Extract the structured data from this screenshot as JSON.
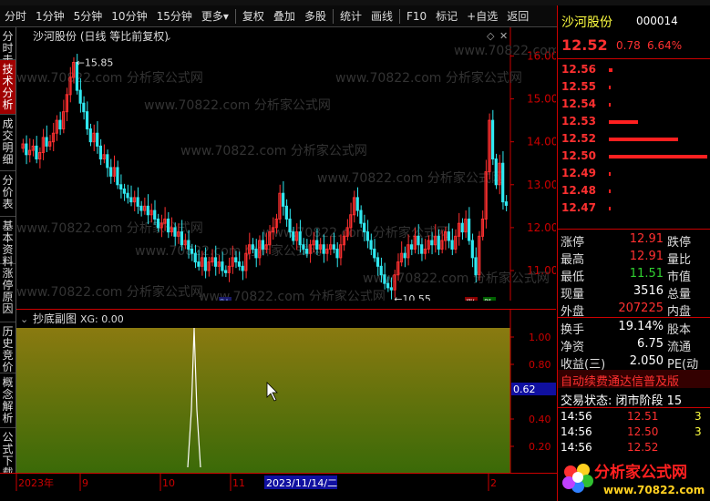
{
  "toolbar": {
    "items": [
      "分时",
      "1分钟",
      "5分钟",
      "10分钟",
      "15分钟",
      "更多",
      "复权",
      "叠加",
      "多股",
      "统计",
      "画线",
      "F10",
      "标记",
      "+自选",
      "返回"
    ],
    "more_arrow": "▾"
  },
  "sidebar": {
    "items": [
      {
        "label": "分时走势",
        "active": false
      },
      {
        "label": "技术分析",
        "active": true
      },
      {
        "label": "成交明细",
        "active": false
      },
      {
        "label": "分价表",
        "active": false
      },
      {
        "label": "基本资料",
        "active": false
      },
      {
        "label": "涨停原因",
        "active": false
      },
      {
        "label": "历史竞价",
        "active": false
      },
      {
        "label": "概念解析",
        "active": false
      },
      {
        "label": "公式下载",
        "active": false
      }
    ]
  },
  "main_chart": {
    "title": "沙河股份 (日线 等比前复权)",
    "high_label": "15.85",
    "low_label": "10.55",
    "cai_marker": "财",
    "limit_up_marker": "涨",
    "limit_down_marker": "跌",
    "y_ticks": [
      "16.00",
      "15.00",
      "14.00",
      "13.00",
      "12.00",
      "11.00"
    ]
  },
  "sub_chart": {
    "title": "抄底副图",
    "indicator": "XG: 0.00",
    "y_ticks": [
      "1.00",
      "0.80",
      "0.62",
      "0.40",
      "0.20"
    ],
    "cursor_value": "0.62"
  },
  "x_axis": {
    "labels": [
      "2023年",
      "9",
      "10",
      "11",
      "2"
    ],
    "cursor_date": "2023/11/14/二"
  },
  "quote": {
    "name": "沙河股份",
    "code": "000014",
    "price": "12.52",
    "change": "0.78",
    "pct": "6.64%",
    "ladder": [
      {
        "price": "12.56",
        "bar": 0.04
      },
      {
        "price": "12.55",
        "bar": 0.02
      },
      {
        "price": "12.54",
        "bar": 0.02
      },
      {
        "price": "12.53",
        "bar": 0.3
      },
      {
        "price": "12.52",
        "bar": 0.7
      },
      {
        "price": "12.50",
        "bar": 1.0
      },
      {
        "price": "12.49",
        "bar": 0.02
      },
      {
        "price": "12.48",
        "bar": 0.02
      },
      {
        "price": "12.47",
        "bar": 0.02
      }
    ],
    "stats": [
      {
        "l1": "涨停",
        "v1": "12.91",
        "c1": "red",
        "l2": "跌停"
      },
      {
        "l1": "最高",
        "v1": "12.91",
        "c1": "red",
        "l2": "量比"
      },
      {
        "l1": "最低",
        "v1": "11.51",
        "c1": "grn",
        "l2": "市值"
      },
      {
        "l1": "现量",
        "v1": "3516",
        "c1": "wht",
        "l2": "总量"
      },
      {
        "l1": "外盘",
        "v1": "207225",
        "c1": "red",
        "l2": "内盘"
      },
      {
        "l1": "换手",
        "v1": "19.14%",
        "c1": "wht",
        "l2": "股本"
      },
      {
        "l1": "净资",
        "v1": "6.75",
        "c1": "wht",
        "l2": "流通"
      },
      {
        "l1": "收益(三)",
        "v1": "2.050",
        "c1": "wht",
        "l2": "PE(动"
      }
    ],
    "ticker": "自动续费通达信普及版",
    "trade_status": "交易状态: 闭市阶段 15",
    "ticks": [
      {
        "time": "14:56",
        "price": "12.51",
        "vol": "3"
      },
      {
        "time": "14:56",
        "price": "12.50",
        "vol": "3"
      },
      {
        "time": "14:56",
        "price": "12.52",
        "vol": ""
      }
    ]
  },
  "watermark": "www.70822.com 分析家公式网",
  "logo": {
    "text": "分析家公式网",
    "url": "www.70822.com"
  }
}
